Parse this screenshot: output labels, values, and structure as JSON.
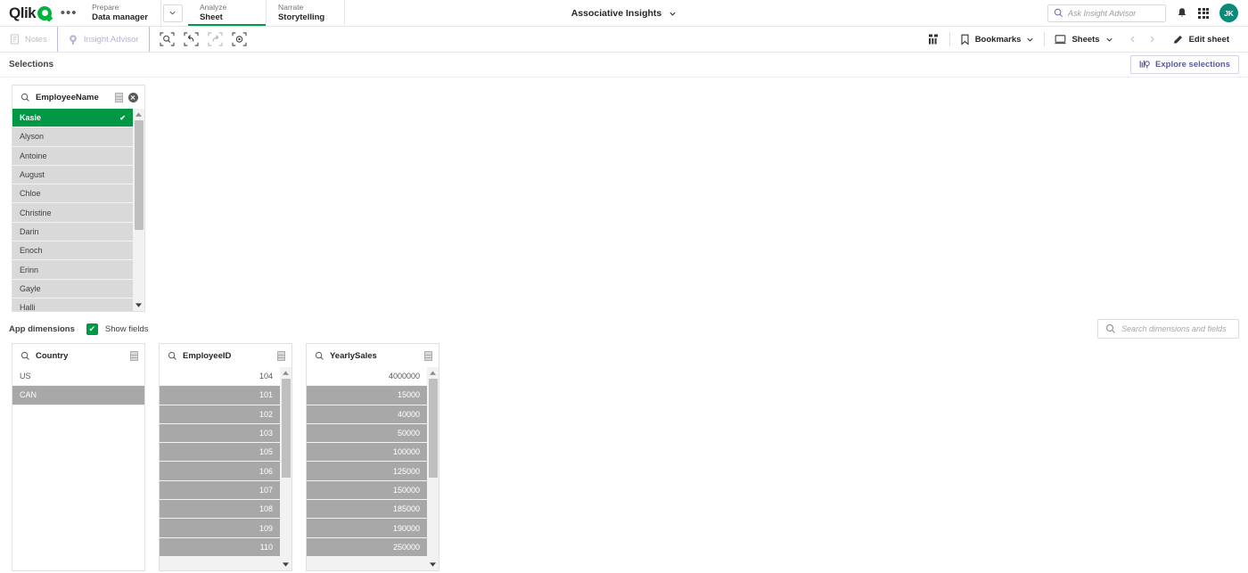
{
  "brand": {
    "name": "Qlik",
    "accent_green": "#009845",
    "logo_green": "#00b33c",
    "purple": "#5b5a9c",
    "avatar_bg": "#0b8a7a"
  },
  "topbar": {
    "overflow_label": "•••",
    "nav": [
      {
        "top": "Prepare",
        "bottom": "Data manager",
        "active": false
      },
      {
        "top": "Analyze",
        "bottom": "Sheet",
        "active": true
      },
      {
        "top": "Narrate",
        "bottom": "Storytelling",
        "active": false
      }
    ],
    "app_title": "Associative Insights",
    "search_placeholder": "Ask Insight Advisor",
    "avatar_initials": "JK",
    "icons": {
      "search": "search-icon",
      "caret": "chevron-down-icon",
      "bell": "notification-bell-icon",
      "grid": "app-grid-icon"
    }
  },
  "toolbar": {
    "notes_label": "Notes",
    "insight_label": "Insight Advisor",
    "selection_tools": [
      {
        "name": "selection-search-icon",
        "disabled": false
      },
      {
        "name": "step-back-icon",
        "disabled": false
      },
      {
        "name": "step-forward-icon",
        "disabled": true
      },
      {
        "name": "clear-all-selections-icon",
        "disabled": false
      }
    ],
    "sheet_view_icon": "sheet-grid-icon",
    "bookmarks_label": "Bookmarks",
    "sheets_label": "Sheets",
    "edit_sheet_label": "Edit sheet",
    "prev_label": "‹",
    "next_label": "›"
  },
  "selections_bar": {
    "title": "Selections",
    "explore_label": "Explore selections"
  },
  "selection_panel": {
    "title": "EmployeeName",
    "rows": [
      {
        "value": "Kasie",
        "state": "selected"
      },
      {
        "value": "Alyson",
        "state": "optional"
      },
      {
        "value": "Antoine",
        "state": "optional"
      },
      {
        "value": "August",
        "state": "optional"
      },
      {
        "value": "Chloe",
        "state": "optional"
      },
      {
        "value": "Christine",
        "state": "optional"
      },
      {
        "value": "Darin",
        "state": "optional"
      },
      {
        "value": "Enoch",
        "state": "optional"
      },
      {
        "value": "Erinn",
        "state": "optional"
      },
      {
        "value": "Gayle",
        "state": "optional"
      },
      {
        "value": "Halli",
        "state": "optional"
      }
    ],
    "check_glyph": "✔",
    "scroll_thumb_top_pct": 0,
    "scroll_thumb_height_pct": 61
  },
  "dimensions_bar": {
    "title": "App dimensions",
    "show_fields_label": "Show fields",
    "show_fields_checked": true,
    "check_glyph": "✔",
    "search_placeholder": "Search dimensions and fields"
  },
  "field_panels": [
    {
      "id": "pCountry",
      "title": "Country",
      "align": "left",
      "has_scrollbar": false,
      "scroll_thumb_top_pct": 0,
      "scroll_thumb_height_pct": 0,
      "rows": [
        {
          "value": "US",
          "state": "alternative"
        },
        {
          "value": "CAN",
          "state": "excluded"
        }
      ]
    },
    {
      "id": "pEmpId",
      "title": "EmployeeID",
      "align": "right",
      "has_scrollbar": true,
      "scroll_thumb_top_pct": 0,
      "scroll_thumb_height_pct": 55,
      "rows": [
        {
          "value": "104",
          "state": "alternative"
        },
        {
          "value": "101",
          "state": "excluded"
        },
        {
          "value": "102",
          "state": "excluded"
        },
        {
          "value": "103",
          "state": "excluded"
        },
        {
          "value": "105",
          "state": "excluded"
        },
        {
          "value": "106",
          "state": "excluded"
        },
        {
          "value": "107",
          "state": "excluded"
        },
        {
          "value": "108",
          "state": "excluded"
        },
        {
          "value": "109",
          "state": "excluded"
        },
        {
          "value": "110",
          "state": "excluded"
        }
      ]
    },
    {
      "id": "pSales",
      "title": "YearlySales",
      "align": "right",
      "has_scrollbar": true,
      "scroll_thumb_top_pct": 0,
      "scroll_thumb_height_pct": 55,
      "rows": [
        {
          "value": "4000000",
          "state": "alternative"
        },
        {
          "value": "15000",
          "state": "excluded"
        },
        {
          "value": "40000",
          "state": "excluded"
        },
        {
          "value": "50000",
          "state": "excluded"
        },
        {
          "value": "100000",
          "state": "excluded"
        },
        {
          "value": "125000",
          "state": "excluded"
        },
        {
          "value": "150000",
          "state": "excluded"
        },
        {
          "value": "185000",
          "state": "excluded"
        },
        {
          "value": "190000",
          "state": "excluded"
        },
        {
          "value": "250000",
          "state": "excluded"
        }
      ]
    }
  ]
}
